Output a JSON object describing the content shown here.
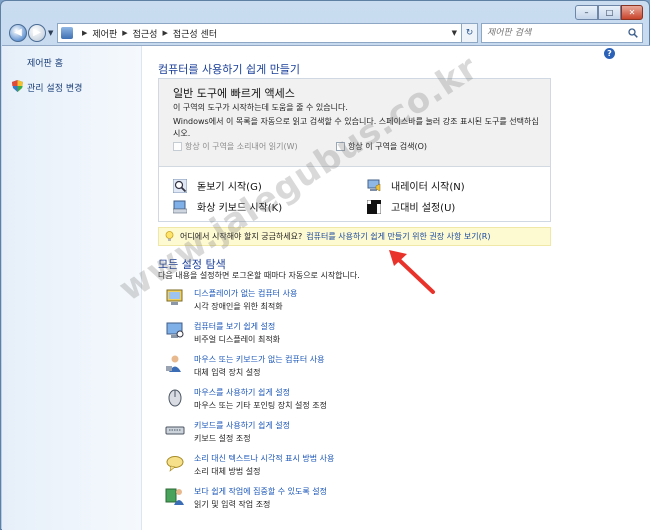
{
  "window": {
    "caption": {
      "min": "–",
      "max": "□",
      "close": "✕"
    }
  },
  "address": {
    "crumbs": [
      "제어판",
      "접근성",
      "접근성 센터"
    ],
    "search_placeholder": "제어판 검색"
  },
  "sidebar": {
    "home": "제어판 홈",
    "admin": "관리 설정 변경"
  },
  "main": {
    "title": "컴퓨터를 사용하기 쉽게 만들기",
    "panel": {
      "title": "일반 도구에 빠르게 액세스",
      "p1": "이 구역의 도구가 시작하는데 도움을 줄 수 있습니다.",
      "p2": "Windows에서 이 목록을 자동으로 읽고 검색할 수 있습니다. 스페이스바를 눌러 강조 표시된 도구를 선택하십시오.",
      "check1": "항상 이 구역을 소리내어 읽기(W)",
      "check2": "항상 이 구역을 검색(O)",
      "tools": {
        "magnifier": "돋보기 시작(G)",
        "narrator": "내레이터 시작(N)",
        "keyboard": "화상 키보드 시작(K)",
        "contrast": "고대비 설정(U)"
      }
    },
    "tip": {
      "text": "어디에서 시작해야 할지 궁금하세요?",
      "link": "컴퓨터를 사용하기 쉽게 만들기 위한 권장 사항 보기(R)"
    },
    "explore": {
      "title": "모든 설정 탐색",
      "subtitle": "다음 내용을 설정하면 로그온할 때마다 자동으로 시작합니다.",
      "items": [
        {
          "link": "디스플레이가 없는 컴퓨터 사용",
          "desc": "시각 장애인을 위한 최적화"
        },
        {
          "link": "컴퓨터를 보기 쉽게 설정",
          "desc": "비주얼 디스플레이 최적화"
        },
        {
          "link": "마우스 또는 키보드가 없는 컴퓨터 사용",
          "desc": "대체 입력 장치 설정"
        },
        {
          "link": "마우스를 사용하기 쉽게 설정",
          "desc": "마우스 또는 기타 포인팅 장치 설정 조정"
        },
        {
          "link": "키보드를 사용하기 쉽게 설정",
          "desc": "키보드 설정 조정"
        },
        {
          "link": "소리 대신 텍스트나 시각적 표시 방법 사용",
          "desc": "소리 대체 방법 설정"
        },
        {
          "link": "보다 쉽게 작업에 집중할 수 있도록 설정",
          "desc": "읽기 및 입력 작업 조정"
        }
      ]
    }
  },
  "watermark": "www.jalegubus.co.kr",
  "colors": {
    "link": "#1a56b8",
    "heading": "#1a3f9a",
    "tip_bg": "#fdf9d1",
    "arrow": "#e8322a"
  }
}
